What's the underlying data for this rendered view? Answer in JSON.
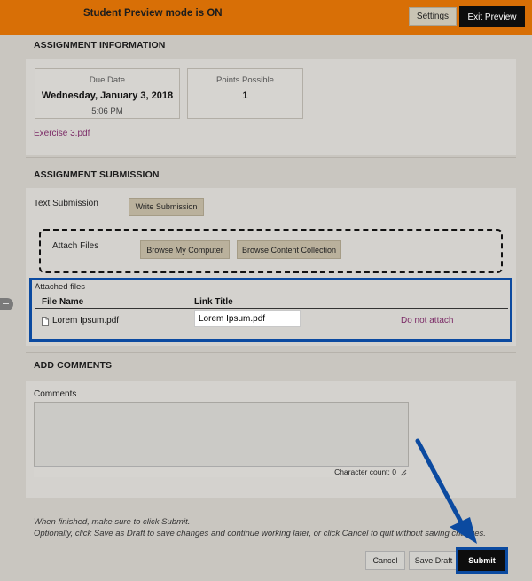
{
  "preview_bar": {
    "message": "Student Preview mode is ON",
    "settings_label": "Settings",
    "exit_label": "Exit Preview"
  },
  "assignment_info": {
    "heading": "ASSIGNMENT INFORMATION",
    "due_date_label": "Due Date",
    "due_date": "Wednesday, January 3, 2018",
    "due_time": "5:06 PM",
    "points_label": "Points Possible",
    "points": "1",
    "attachment": "Exercise 3.pdf"
  },
  "submission": {
    "heading": "ASSIGNMENT SUBMISSION",
    "text_label": "Text Submission",
    "write_button": "Write Submission",
    "attach_label": "Attach Files",
    "browse_computer": "Browse My Computer",
    "browse_collection": "Browse Content Collection",
    "attached_caption": "Attached files",
    "col_file_name": "File Name",
    "col_link_title": "Link Title",
    "file_name": "Lorem Ipsum.pdf",
    "link_title": "Lorem Ipsum.pdf",
    "remove_link": "Do not attach"
  },
  "comments": {
    "heading": "ADD COMMENTS",
    "label": "Comments",
    "char_count": "Character count: 0"
  },
  "footer": {
    "instruction_1": "When finished, make sure to click Submit.",
    "instruction_2": "Optionally, click Save as Draft to save changes and continue working later, or click Cancel to quit without saving changes.",
    "cancel": "Cancel",
    "save_draft": "Save Draft",
    "submit": "Submit"
  },
  "colors": {
    "preview_bar": "#d86f06",
    "highlight": "#0b4aa0",
    "link": "#7b2a66"
  }
}
